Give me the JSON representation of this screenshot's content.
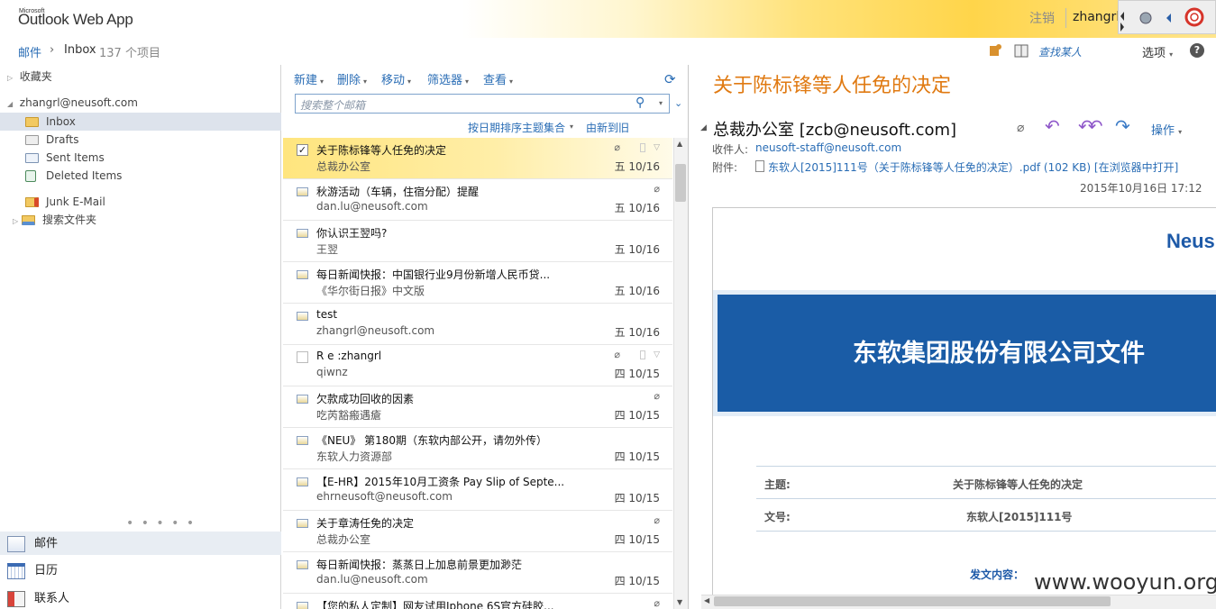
{
  "header": {
    "logo_small": "Microsoft",
    "logo": "Outlook Web App",
    "signout": "注销",
    "username": "zhangrl"
  },
  "breadcrumb": {
    "mail": "邮件",
    "folder": "Inbox",
    "count": "137 个项目"
  },
  "top_right": {
    "find_people": "查找某人",
    "options": "选项",
    "help": "?"
  },
  "nav": {
    "favorites": "收藏夹",
    "account": "zhangrl@neusoft.com",
    "folders": [
      {
        "label": "Inbox"
      },
      {
        "label": "Drafts"
      },
      {
        "label": "Sent Items"
      },
      {
        "label": "Deleted Items"
      },
      {
        "label": "Junk E-Mail"
      },
      {
        "label": "搜索文件夹"
      }
    ],
    "dots": "• • • • •",
    "modules": [
      {
        "label": "邮件"
      },
      {
        "label": "日历"
      },
      {
        "label": "联系人"
      }
    ]
  },
  "toolbar": {
    "new": "新建",
    "delete": "删除",
    "move": "移动",
    "filter": "筛选器",
    "view": "查看"
  },
  "search": {
    "placeholder": "搜索整个邮箱"
  },
  "sort": {
    "by": "按日期排序主题集合",
    "order": "由新到旧"
  },
  "messages": [
    {
      "subject": "关于陈标锋等人任免的决定",
      "from": "总裁办公室",
      "date": "五 10/16"
    },
    {
      "subject": "秋游活动（车辆，住宿分配）提醒",
      "from": "dan.lu@neusoft.com",
      "date": "五 10/16"
    },
    {
      "subject": "你认识王翌吗?",
      "from": "王翌",
      "date": "五 10/16"
    },
    {
      "subject": "每日新闻快报：中国银行业9月份新增人民币贷...",
      "from": "《华尔街日报》中文版",
      "date": "五 10/16"
    },
    {
      "subject": "test",
      "from": "zhangrl@neusoft.com",
      "date": "五 10/16"
    },
    {
      "subject": "R e :zhangrl",
      "from": "qiwnz",
      "date": "四 10/15"
    },
    {
      "subject": "欠款成功回收的因素",
      "from": "吃芮豁瘢遇瘡",
      "date": "四 10/15"
    },
    {
      "subject": "《NEU》 第180期（东软内部公开，请勿外传）",
      "from": "东软人力资源部",
      "date": "四 10/15"
    },
    {
      "subject": "【E-HR】2015年10月工资条 Pay Slip of Septe...",
      "from": "ehrneusoft@neusoft.com",
      "date": "四 10/15"
    },
    {
      "subject": "关于章涛任免的决定",
      "from": "总裁办公室",
      "date": "四 10/15"
    },
    {
      "subject": "每日新闻快报：蒸蒸日上加息前景更加渺茫",
      "from": "dan.lu@neusoft.com",
      "date": "四 10/15"
    },
    {
      "subject": "【您的私人定制】网友试用Iphone 6S官方硅胶...",
      "from": "",
      "date": ""
    }
  ],
  "reading": {
    "subject": "关于陈标锋等人任免的决定",
    "sender": "总裁办公室 [zcb@neusoft.com]",
    "to_label": "收件人:",
    "to": "neusoft-staff@neusoft.com",
    "attach_label": "附件:",
    "attachment": "东软人[2015]111号（关于陈标锋等人任免的决定）.pdf (102 KB) [在浏览器中打开]",
    "date": "2015年10月16日 17:12",
    "actions": "操作",
    "doc": {
      "logo": "Neus",
      "banner": "东软集团股份有限公司文件",
      "subject_label": "主题:",
      "subject_value": "关于陈标锋等人任免的决定",
      "number_label": "文号:",
      "number_value": "东软人[2015]111号",
      "body_label": "发文内容："
    }
  },
  "watermark": "www.wooyun.org",
  "colors": {
    "link": "#2a6db5",
    "subject_orange": "#e07a12",
    "banner_blue": "#1a5ca6",
    "selected_row": "#ffe57e"
  }
}
